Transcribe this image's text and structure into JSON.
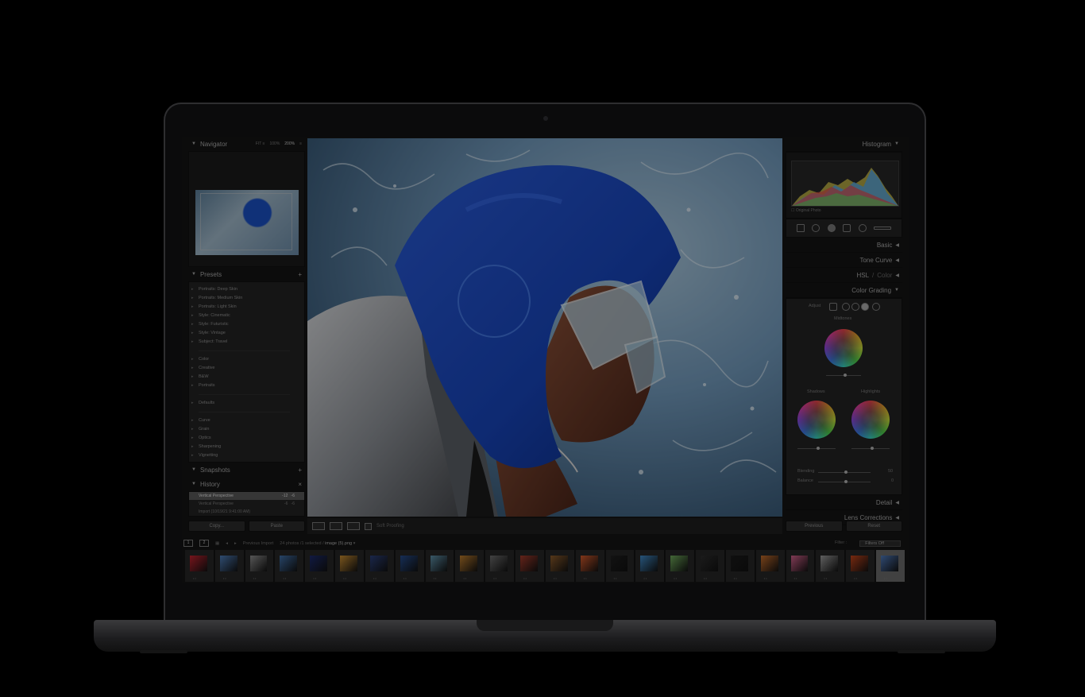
{
  "navigator": {
    "title": "Navigator",
    "zoom": [
      "FIT ≡",
      "100%",
      "200%",
      "≡"
    ]
  },
  "presets": {
    "title": "Presets",
    "add": "+",
    "groups": [
      [
        "Portraits: Deep Skin",
        "Portraits: Medium Skin",
        "Portraits: Light Skin",
        "Style: Cinematic",
        "Style: Futuristic",
        "Style: Vintage",
        "Subject: Travel"
      ],
      [
        "Color",
        "Creative",
        "B&W",
        "Portraits"
      ],
      [
        "Defaults"
      ],
      [
        "Curve",
        "Grain",
        "Optics",
        "Sharpening",
        "Vignetting"
      ]
    ]
  },
  "snapshots": {
    "title": "Snapshots",
    "add": "+"
  },
  "history": {
    "title": "History",
    "close": "×",
    "items": [
      {
        "label": "Vertical Perspective",
        "a": "-12",
        "b": "-6"
      },
      {
        "label": "Vertical Perspective",
        "a": "-6",
        "b": "-6"
      },
      {
        "label": "Import (10/19/21 9:41:00 AM)",
        "a": "",
        "b": ""
      }
    ]
  },
  "left_buttons": {
    "copy": "Copy...",
    "paste": "Paste"
  },
  "toolbar": {
    "soft_proofing": "Soft Proofing"
  },
  "right": {
    "histogram": "Histogram",
    "original_photo": "Original Photo",
    "basic": "Basic",
    "tone_curve": "Tone Curve",
    "hsl": "HSL",
    "hsl_sep": "/",
    "hsl_color": "Color",
    "color_grading": "Color Grading",
    "adjust": "Adjust",
    "midtones": "Midtones",
    "shadows": "Shadows",
    "highlights": "Highlights",
    "blending": "Blending",
    "blending_val": "50",
    "balance": "Balance",
    "balance_val": "0",
    "detail": "Detail",
    "lens_corrections": "Lens Corrections",
    "previous": "Previous",
    "reset": "Reset"
  },
  "filmbar": {
    "page1": "1",
    "page2": "2",
    "source": "Previous Import",
    "count": "24 photos /1 selected /",
    "filename": "image (5).png",
    "filter_label": "Filter :",
    "filter_value": "Filters Off"
  },
  "film": {
    "thumb_colors": [
      "#c0222e",
      "#4d7cb7",
      "#8c8c8c",
      "#3f6ea6",
      "#1b2a6a",
      "#c48a30",
      "#2b3f78",
      "#244a8a",
      "#5d8fa7",
      "#b87a2c",
      "#6c6c6c",
      "#a13a2a",
      "#8a5a2a",
      "#d0582a",
      "#1e1e1e",
      "#3f88c4",
      "#6ea85a",
      "#2c2c2c",
      "#1a1a1a",
      "#c06a2a",
      "#d0608a",
      "#9a9a9a",
      "#c0431a",
      "#4d78b8"
    ],
    "selected_index": 23
  }
}
